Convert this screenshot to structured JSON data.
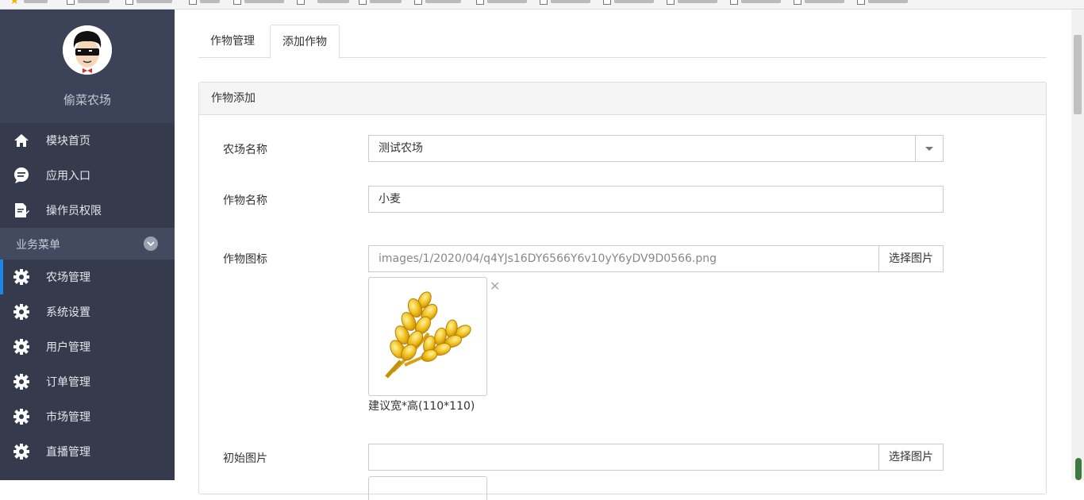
{
  "app": {
    "farm_name": "偷菜农场"
  },
  "sidebar": {
    "items": [
      {
        "label": "模块首页",
        "icon": "home-icon"
      },
      {
        "label": "应用入口",
        "icon": "chat-icon"
      },
      {
        "label": "操作员权限",
        "icon": "document-edit-icon"
      }
    ],
    "section_label": "业务菜单",
    "menu": [
      {
        "label": "农场管理",
        "icon": "gear-icon",
        "active": true
      },
      {
        "label": "系统设置",
        "icon": "gear-icon"
      },
      {
        "label": "用户管理",
        "icon": "gear-icon"
      },
      {
        "label": "订单管理",
        "icon": "gear-icon"
      },
      {
        "label": "市场管理",
        "icon": "gear-icon"
      },
      {
        "label": "直播管理",
        "icon": "gear-icon"
      }
    ]
  },
  "tabs": [
    {
      "label": "作物管理"
    },
    {
      "label": "添加作物",
      "active": true
    }
  ],
  "panel": {
    "title": "作物添加"
  },
  "form": {
    "farm": {
      "label": "农场名称",
      "value": "测试农场"
    },
    "crop": {
      "label": "作物名称",
      "value": "小麦"
    },
    "icon": {
      "label": "作物图标",
      "value": "images/1/2020/04/q4YJs16DY6566Y6v10yY6yDV9D0566.png",
      "button": "选择图片",
      "hint": "建议宽*高(110*110)"
    },
    "initial_image": {
      "label": "初始图片",
      "value": "",
      "button": "选择图片"
    }
  },
  "colors": {
    "sidebar_bg": "#353b4d",
    "active_accent": "#1e88e5"
  }
}
